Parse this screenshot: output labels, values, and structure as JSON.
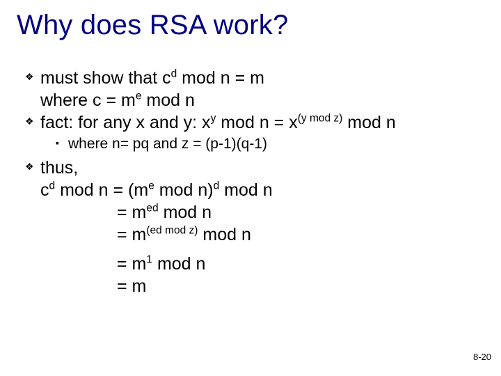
{
  "title": "Why does RSA work?",
  "bullets": {
    "b1_l1_pre": "must show that c",
    "b1_l1_sup": "d",
    "b1_l1_post": " mod n = m",
    "b1_l2_pre": "where c = m",
    "b1_l2_sup": "e",
    "b1_l2_post": " mod n",
    "b2_pre": "fact: for any x and y: x",
    "b2_sup1": "y",
    "b2_mid": " mod n = x",
    "b2_sup2": "(y mod z)",
    "b2_post": " mod n",
    "sub1": "where n= pq and z = (p-1)(q-1)",
    "b3_l1": "thus,",
    "b3_l2_a": "c",
    "b3_l2_a_sup": "d",
    "b3_l2_b": " mod n = (m",
    "b3_l2_b_sup": "e",
    "b3_l2_c": " mod n)",
    "b3_l2_c_sup": "d",
    "b3_l2_d": " mod n",
    "b3_l3_a": "= m",
    "b3_l3_sup": "ed",
    "b3_l3_b": " mod n",
    "b3_l4_a": "= m",
    "b3_l4_sup": "(ed mod z)",
    "b3_l4_b": " mod n",
    "b3_l5_a": "= m",
    "b3_l5_sup": "1",
    "b3_l5_b": " mod n",
    "b3_l6": "= m"
  },
  "page": "8-20"
}
